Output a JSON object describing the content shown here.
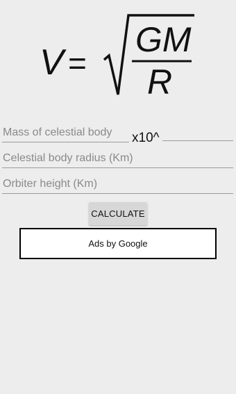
{
  "formula": {
    "lhs": "V",
    "equals": "=",
    "numerator": "GM",
    "denominator": "R"
  },
  "fields": {
    "mass_placeholder": "Mass of celestial body",
    "exponent_label": "x10^",
    "exponent_placeholder": "",
    "radius_placeholder": "Celestial body radius (Km)",
    "height_placeholder": "Orbiter height (Km)"
  },
  "actions": {
    "calculate_label": "CALCULATE"
  },
  "ad": {
    "label": "Ads by Google"
  }
}
